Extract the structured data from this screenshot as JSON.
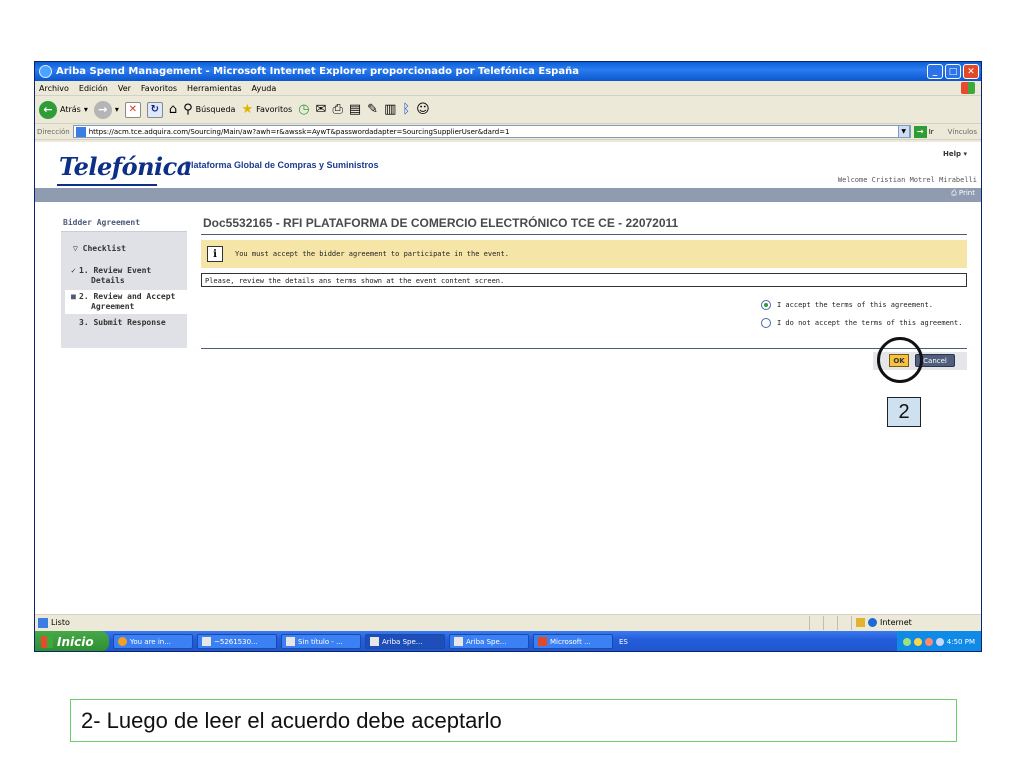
{
  "window": {
    "title": "Ariba Spend Management - Microsoft Internet Explorer proporcionado por Telefónica España"
  },
  "menu": [
    "Archivo",
    "Edición",
    "Ver",
    "Favoritos",
    "Herramientas",
    "Ayuda"
  ],
  "toolbar": {
    "back_label": "Atrás",
    "search_label": "Búsqueda",
    "favorites_label": "Favoritos"
  },
  "address": {
    "label": "Dirección",
    "url": "https://acm.tce.adquira.com/Sourcing/Main/aw?awh=r&awssk=AywT&passwordadapter=SourcingSupplierUser&dard=1",
    "go_label": "Ir",
    "links_label": "Vínculos"
  },
  "page": {
    "logo_text": "Telefónica",
    "platform": "Plataforma Global de Compras y Suministros",
    "help": "Help ▾",
    "welcome": "Welcome Cristian Motrel Mirabelli",
    "print": "Print",
    "sidebar": {
      "title": "Bidder Agreement",
      "checklist": "Checklist",
      "steps": [
        {
          "marker": "✓",
          "label_line1": "1. Review Event",
          "label_line2": "Details"
        },
        {
          "marker": "■",
          "label_line1": "2. Review and Accept",
          "label_line2": "Agreement"
        },
        {
          "marker": "",
          "label_line1": "3. Submit Response",
          "label_line2": ""
        }
      ]
    },
    "doc_title": "Doc5532165 - RFI PLATAFORMA DE COMERCIO ELECTRÓNICO TCE CE - 22072011",
    "notice": "You must accept the bidder agreement to participate in the event.",
    "review_text": "Please, review the details ans terms shown at the event content screen.",
    "accept_label": "I accept the terms of this agreement.",
    "decline_label": "I do not accept the terms of this agreement.",
    "ok_label": "OK",
    "cancel_label": "Cancel"
  },
  "status": {
    "text": "Listo",
    "zone": "Internet"
  },
  "taskbar": {
    "start": "Inicio",
    "tasks": [
      "You are in...",
      "~5261530...",
      "Sin título - ...",
      "Ariba Spe...",
      "Ariba Spe...",
      "Microsoft ..."
    ],
    "lang": "ES",
    "clock": "4:50 PM"
  },
  "annotation": {
    "step_number": "2",
    "caption": "2- Luego de leer el acuerdo debe aceptarlo"
  }
}
